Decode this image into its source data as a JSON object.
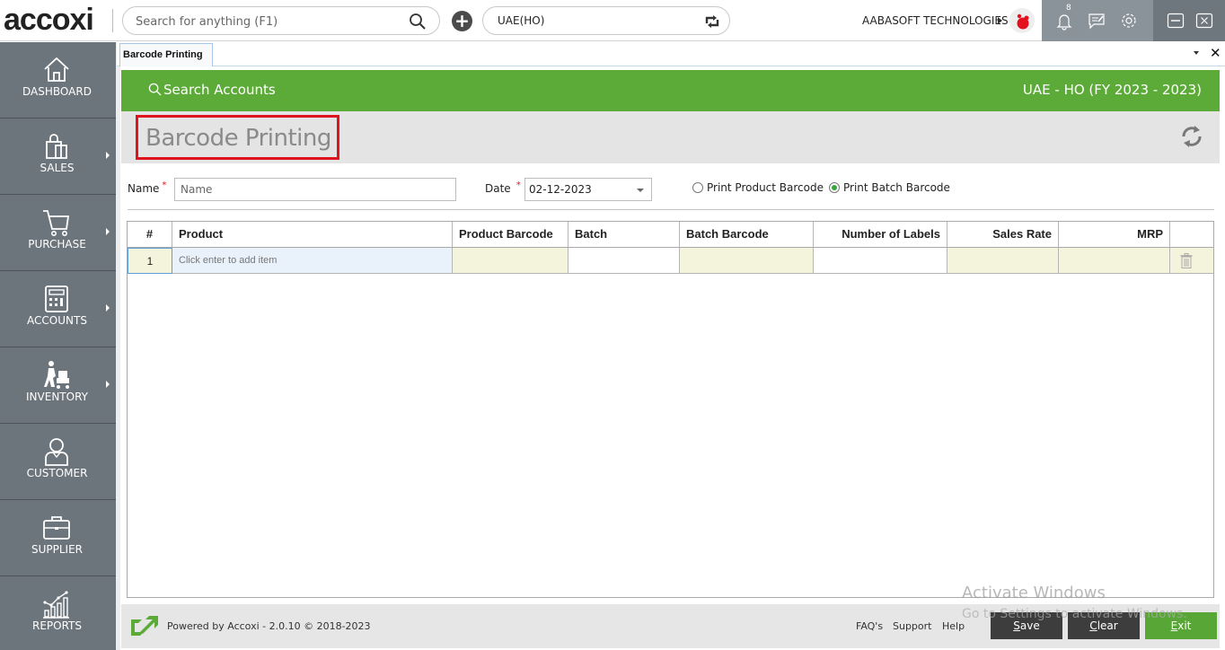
{
  "app": {
    "logo_text": "accoxi",
    "search": {
      "placeholder": "Search for anything (F1)",
      "value": ""
    },
    "branch": "UAE(HO)",
    "company": "AABASOFT TECHNOLOGIES",
    "notification_count": "8",
    "icons": {
      "search": "search-icon",
      "add": "plus-circle-icon",
      "switch_branch": "swap-icon",
      "notifications": "bell-icon",
      "messages": "chat-edit-icon",
      "settings": "gear-icon",
      "minimize": "minimize-icon",
      "close": "close-icon"
    }
  },
  "sidebar": {
    "items": [
      {
        "label": "DASHBOARD",
        "icon": "home-icon",
        "has_submenu": false
      },
      {
        "label": "SALES",
        "icon": "shopping-bag-icon",
        "has_submenu": true
      },
      {
        "label": "PURCHASE",
        "icon": "cart-icon",
        "has_submenu": true
      },
      {
        "label": "ACCOUNTS",
        "icon": "calculator-icon",
        "has_submenu": true
      },
      {
        "label": "INVENTORY",
        "icon": "trolley-worker-icon",
        "has_submenu": true
      },
      {
        "label": "CUSTOMER",
        "icon": "person-icon",
        "has_submenu": false
      },
      {
        "label": "SUPPLIER",
        "icon": "briefcase-icon",
        "has_submenu": false
      },
      {
        "label": "REPORTS",
        "icon": "chart-icon",
        "has_submenu": false
      }
    ]
  },
  "tabs": [
    {
      "label": "Barcode Printing",
      "active": true
    }
  ],
  "header": {
    "search_accounts": "Search Accounts",
    "fy_label": "UAE - HO (FY 2023 - 2023)"
  },
  "page": {
    "title": "Barcode Printing"
  },
  "form": {
    "name_label": "Name",
    "name_placeholder": "Name",
    "name_value": "",
    "required_mark": "*",
    "date_label": "Date",
    "date_value": "02-12-2023",
    "radio_options": [
      {
        "label": "Print Product Barcode",
        "selected": false
      },
      {
        "label": "Print Batch Barcode",
        "selected": true
      }
    ]
  },
  "grid": {
    "columns": [
      "#",
      "Product",
      "Product Barcode",
      "Batch",
      "Batch Barcode",
      "Number of Labels",
      "Sales Rate",
      "MRP",
      ""
    ],
    "rows": [
      {
        "index": "1",
        "product": "Click enter to add item",
        "product_barcode": "",
        "batch": "",
        "batch_barcode": "",
        "labels": "",
        "sales_rate": "",
        "mrp": ""
      }
    ]
  },
  "footer": {
    "powered_by": "Powered by Accoxi - 2.0.10 © 2018-2023",
    "links": [
      "FAQ's",
      "Support",
      "Help"
    ],
    "buttons": {
      "save": {
        "accel": "S",
        "rest": "ave"
      },
      "clear": {
        "accel": "C",
        "rest": "lear"
      },
      "exit": {
        "accel": "E",
        "rest": "xit"
      }
    }
  },
  "watermark": {
    "line1": "Activate Windows",
    "line2": "Go to Settings to activate Windows."
  },
  "colors": {
    "brand_green": "#5cab38",
    "sidebar_bg": "#6d757c",
    "title_highlight": "#e0141e"
  }
}
